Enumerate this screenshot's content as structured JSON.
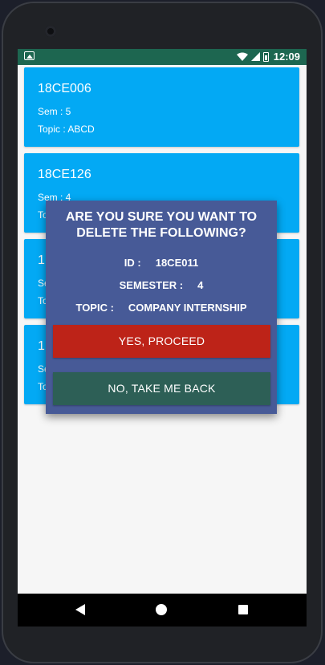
{
  "status_bar": {
    "time": "12:09",
    "background_color": "#1d6650",
    "icons": [
      "notification-icon",
      "wifi-icon",
      "cell-signal-icon",
      "battery-icon"
    ]
  },
  "cards": [
    {
      "id": "18CE006",
      "sem": "Sem :  5",
      "topic": "Topic :  ABCD"
    },
    {
      "id": "18CE126",
      "sem": "Sem :  4",
      "topic": "To"
    },
    {
      "id": "1",
      "sem": "Se",
      "topic": "To"
    },
    {
      "id": "1",
      "sem": "Se",
      "topic": "To"
    }
  ],
  "dialog": {
    "title": "ARE YOU SURE YOU WANT TO DELETE THE FOLLOWING?",
    "id_label": "ID :",
    "id_value": "18CE011",
    "semester_label": "SEMESTER :",
    "semester_value": "4",
    "topic_label": "TOPIC :",
    "topic_value": "COMPANY INTERNSHIP",
    "yes_button": "YES, PROCEED",
    "no_button": "NO, TAKE ME BACK"
  },
  "colors": {
    "card": "#03a9f4",
    "dialog": "#475a97",
    "yes_button": "#bd2318",
    "no_button": "#2d5f56"
  },
  "nav_bar": {
    "icons": [
      "back-icon",
      "home-icon",
      "recents-icon"
    ]
  }
}
